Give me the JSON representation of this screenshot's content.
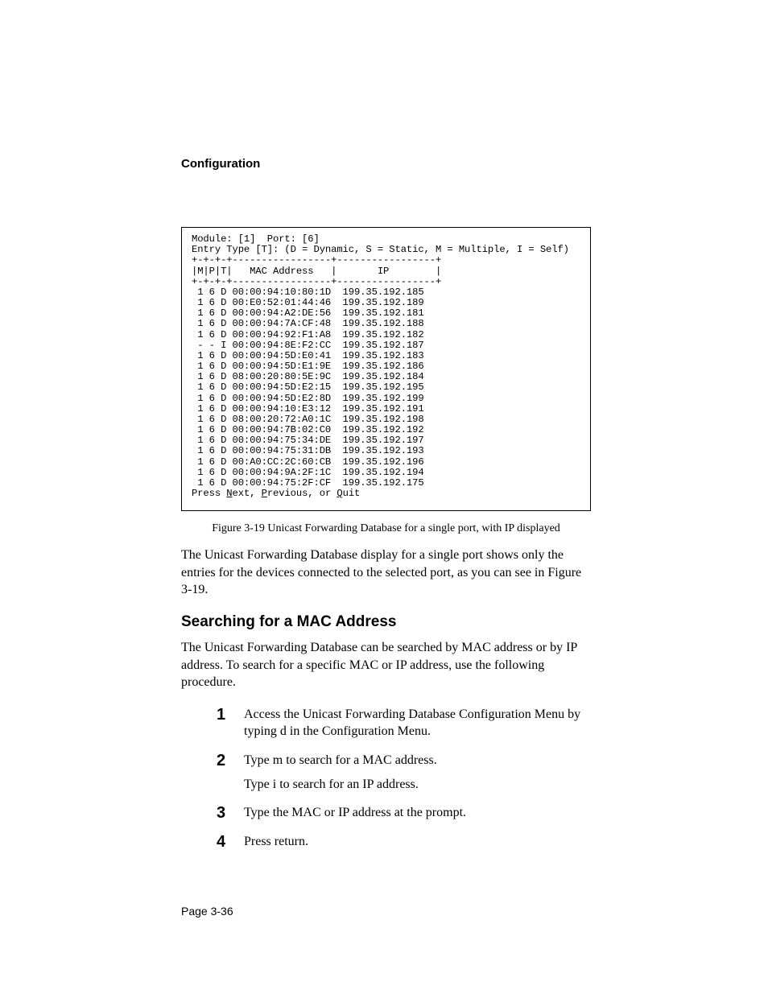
{
  "header": {
    "section_title": "Configuration"
  },
  "terminal": {
    "module_label": "Module: [1]  Port: [6]",
    "entry_type_line": "Entry Type [T]: (D = Dynamic, S = Static, M = Multiple, I = Self)",
    "divider_top": "+-+-+-+-----------------+-----------------+",
    "header_row": "|M|P|T|   MAC Address   |       IP        |",
    "divider_mid": "+-+-+-+-----------------+-----------------+",
    "rows": [
      {
        "m": "1",
        "p": "6",
        "t": "D",
        "mac": "00:00:94:10:80:1D",
        "ip": "199.35.192.185"
      },
      {
        "m": "1",
        "p": "6",
        "t": "D",
        "mac": "00:E0:52:01:44:46",
        "ip": "199.35.192.189"
      },
      {
        "m": "1",
        "p": "6",
        "t": "D",
        "mac": "00:00:94:A2:DE:56",
        "ip": "199.35.192.181"
      },
      {
        "m": "1",
        "p": "6",
        "t": "D",
        "mac": "00:00:94:7A:CF:48",
        "ip": "199.35.192.188"
      },
      {
        "m": "1",
        "p": "6",
        "t": "D",
        "mac": "00:00:94:92:F1:A8",
        "ip": "199.35.192.182"
      },
      {
        "m": "-",
        "p": "-",
        "t": "I",
        "mac": "00:00:94:8E:F2:CC",
        "ip": "199.35.192.187"
      },
      {
        "m": "1",
        "p": "6",
        "t": "D",
        "mac": "00:00:94:5D:E0:41",
        "ip": "199.35.192.183"
      },
      {
        "m": "1",
        "p": "6",
        "t": "D",
        "mac": "00:00:94:5D:E1:9E",
        "ip": "199.35.192.186"
      },
      {
        "m": "1",
        "p": "6",
        "t": "D",
        "mac": "08:00:20:80:5E:9C",
        "ip": "199.35.192.184"
      },
      {
        "m": "1",
        "p": "6",
        "t": "D",
        "mac": "00:00:94:5D:E2:15",
        "ip": "199.35.192.195"
      },
      {
        "m": "1",
        "p": "6",
        "t": "D",
        "mac": "00:00:94:5D:E2:8D",
        "ip": "199.35.192.199"
      },
      {
        "m": "1",
        "p": "6",
        "t": "D",
        "mac": "00:00:94:10:E3:12",
        "ip": "199.35.192.191"
      },
      {
        "m": "1",
        "p": "6",
        "t": "D",
        "mac": "08:00:20:72:A0:1C",
        "ip": "199.35.192.198"
      },
      {
        "m": "1",
        "p": "6",
        "t": "D",
        "mac": "00:00:94:7B:02:C0",
        "ip": "199.35.192.192"
      },
      {
        "m": "1",
        "p": "6",
        "t": "D",
        "mac": "00:00:94:75:34:DE",
        "ip": "199.35.192.197"
      },
      {
        "m": "1",
        "p": "6",
        "t": "D",
        "mac": "00:00:94:75:31:DB",
        "ip": "199.35.192.193"
      },
      {
        "m": "1",
        "p": "6",
        "t": "D",
        "mac": "00:A0:CC:2C:60:CB",
        "ip": "199.35.192.196"
      },
      {
        "m": "1",
        "p": "6",
        "t": "D",
        "mac": "00:00:94:9A:2F:1C",
        "ip": "199.35.192.194"
      },
      {
        "m": "1",
        "p": "6",
        "t": "D",
        "mac": "00:00:94:75:2F:CF",
        "ip": "199.35.192.175"
      }
    ],
    "prompt_prefix": "Press ",
    "prompt_next_u": "N",
    "prompt_next_rest": "ext, ",
    "prompt_prev_u": "P",
    "prompt_prev_rest": "revious, or ",
    "prompt_quit_u": "Q",
    "prompt_quit_rest": "uit"
  },
  "caption": "Figure 3-19   Unicast Forwarding Database for a single port, with IP displayed",
  "paragraph1": "The Unicast Forwarding Database display for a single port shows only the entries for the devices connected to the selected port, as you can see in Figure 3-19.",
  "subheading": "Searching for a MAC Address",
  "paragraph2": "The Unicast Forwarding Database can be searched by MAC address or by IP address. To search for a specific MAC or IP address, use the following procedure.",
  "steps": [
    {
      "num": "1",
      "lines": [
        "Access the Unicast Forwarding Database Configuration Menu by typing d in the Configuration Menu."
      ]
    },
    {
      "num": "2",
      "lines": [
        "Type m to search for a MAC address.",
        "Type i to search for an IP address."
      ]
    },
    {
      "num": "3",
      "lines": [
        "Type the MAC or IP address at the prompt."
      ]
    },
    {
      "num": "4",
      "lines": [
        "Press return."
      ]
    }
  ],
  "page_number": "Page 3-36"
}
